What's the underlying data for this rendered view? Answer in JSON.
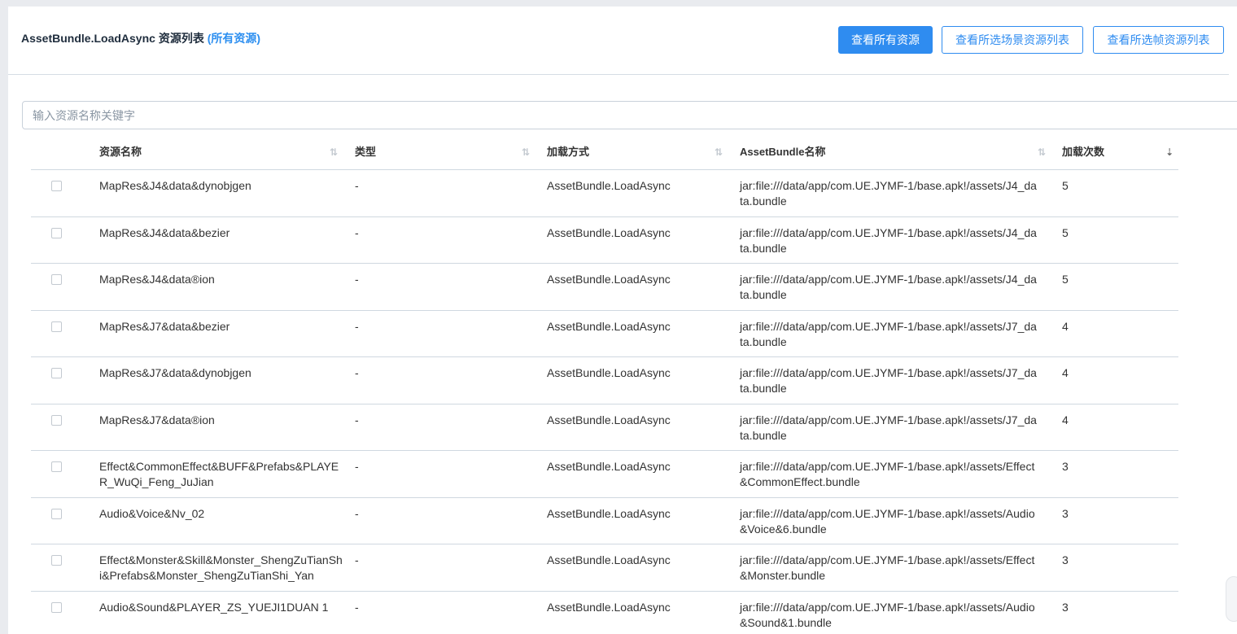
{
  "header": {
    "title": "AssetBundle.LoadAsync 资源列表",
    "title_link": "(所有资源)",
    "buttons": {
      "all": "查看所有资源",
      "scene": "查看所选场景资源列表",
      "frame": "查看所选帧资源列表"
    }
  },
  "search": {
    "placeholder": "输入资源名称关键字",
    "value": ""
  },
  "table": {
    "columns": [
      "资源名称",
      "类型",
      "加载方式",
      "AssetBundle名称",
      "加载次数"
    ],
    "sort_icon": "⇅",
    "sort_active_icon": "⇣",
    "rows": [
      {
        "name": "MapRes&J4&data&dynobjgen",
        "type": "-",
        "method": "AssetBundle.LoadAsync",
        "bundle": "jar:file:///data/app/com.UE.JYMF-1/base.apk!/assets/J4_data.bundle",
        "count": "5"
      },
      {
        "name": "MapRes&J4&data&bezier",
        "type": "-",
        "method": "AssetBundle.LoadAsync",
        "bundle": "jar:file:///data/app/com.UE.JYMF-1/base.apk!/assets/J4_data.bundle",
        "count": "5"
      },
      {
        "name": "MapRes&J4&data®ion",
        "type": "-",
        "method": "AssetBundle.LoadAsync",
        "bundle": "jar:file:///data/app/com.UE.JYMF-1/base.apk!/assets/J4_data.bundle",
        "count": "5"
      },
      {
        "name": "MapRes&J7&data&bezier",
        "type": "-",
        "method": "AssetBundle.LoadAsync",
        "bundle": "jar:file:///data/app/com.UE.JYMF-1/base.apk!/assets/J7_data.bundle",
        "count": "4"
      },
      {
        "name": "MapRes&J7&data&dynobjgen",
        "type": "-",
        "method": "AssetBundle.LoadAsync",
        "bundle": "jar:file:///data/app/com.UE.JYMF-1/base.apk!/assets/J7_data.bundle",
        "count": "4"
      },
      {
        "name": "MapRes&J7&data®ion",
        "type": "-",
        "method": "AssetBundle.LoadAsync",
        "bundle": "jar:file:///data/app/com.UE.JYMF-1/base.apk!/assets/J7_data.bundle",
        "count": "4"
      },
      {
        "name": "Effect&CommonEffect&BUFF&Prefabs&PLAYER_WuQi_Feng_JuJian",
        "type": "-",
        "method": "AssetBundle.LoadAsync",
        "bundle": "jar:file:///data/app/com.UE.JYMF-1/base.apk!/assets/Effect&CommonEffect.bundle",
        "count": "3"
      },
      {
        "name": "Audio&Voice&Nv_02",
        "type": "-",
        "method": "AssetBundle.LoadAsync",
        "bundle": "jar:file:///data/app/com.UE.JYMF-1/base.apk!/assets/Audio&Voice&6.bundle",
        "count": "3"
      },
      {
        "name": "Effect&Monster&Skill&Monster_ShengZuTianShi&Prefabs&Monster_ShengZuTianShi_Yan",
        "type": "-",
        "method": "AssetBundle.LoadAsync",
        "bundle": "jar:file:///data/app/com.UE.JYMF-1/base.apk!/assets/Effect&Monster.bundle",
        "count": "3"
      },
      {
        "name": "Audio&Sound&PLAYER_ZS_YUEJI1DUAN 1",
        "type": "-",
        "method": "AssetBundle.LoadAsync",
        "bundle": "jar:file:///data/app/com.UE.JYMF-1/base.apk!/assets/Audio&Sound&1.bundle",
        "count": "3"
      }
    ]
  }
}
